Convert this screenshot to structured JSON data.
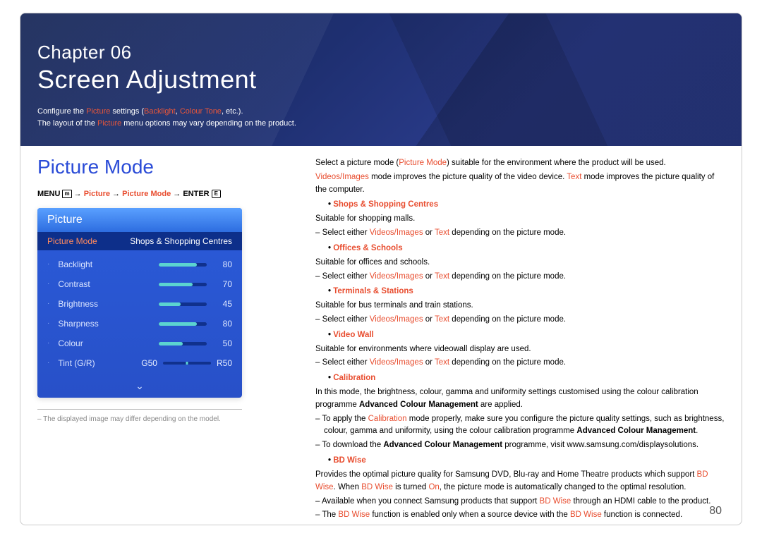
{
  "header": {
    "chapter": "Chapter  06",
    "title": "Screen Adjustment",
    "desc_pre": "Configure the ",
    "desc_picture": "Picture",
    "desc_mid": " settings (",
    "desc_opt1": "Backlight",
    "desc_sep": ", ",
    "desc_opt2": "Colour Tone",
    "desc_post": ", etc.).",
    "desc2_pre": "The layout of the ",
    "desc2_picture": "Picture",
    "desc2_post": " menu options may vary depending on the product."
  },
  "left": {
    "heading": "Picture Mode",
    "nav": {
      "menu": "MENU",
      "arrow": " → ",
      "picture": "Picture",
      "picmode": "Picture Mode",
      "enter": "ENTER"
    },
    "osd": {
      "title": "Picture",
      "modeLabel": "Picture Mode",
      "modeValue": "Shops & Shopping Centres",
      "rows": [
        {
          "label": "Backlight",
          "value": "80",
          "fill": "80%"
        },
        {
          "label": "Contrast",
          "value": "70",
          "fill": "70%"
        },
        {
          "label": "Brightness",
          "value": "45",
          "fill": "45%"
        },
        {
          "label": "Sharpness",
          "value": "80",
          "fill": "80%"
        },
        {
          "label": "Colour",
          "value": "50",
          "fill": "50%"
        }
      ],
      "tint": {
        "label": "Tint (G/R)",
        "g": "G50",
        "r": "R50"
      }
    },
    "footnote": "The displayed image may differ depending on the model."
  },
  "right": {
    "intro1a": "Select a picture mode (",
    "intro1b": "Picture Mode",
    "intro1c": ") suitable for the environment where the product will be used.",
    "intro2a": "Videos/Images",
    "intro2b": " mode improves the picture quality of the video device. ",
    "intro2c": "Text",
    "intro2d": " mode improves the picture quality of the computer.",
    "modes": [
      {
        "title": "Shops & Shopping Centres",
        "desc": "Suitable for shopping malls.",
        "dash_pre": "Select either ",
        "dash_a": "Videos/Images",
        "dash_mid": " or ",
        "dash_b": "Text",
        "dash_post": " depending on the picture mode."
      },
      {
        "title": "Offices & Schools",
        "desc": "Suitable for offices and schools.",
        "dash_pre": "Select either ",
        "dash_a": "Videos/Images",
        "dash_mid": " or ",
        "dash_b": "Text",
        "dash_post": " depending on the picture mode."
      },
      {
        "title": "Terminals & Stations",
        "desc": "Suitable for bus terminals and train stations.",
        "dash_pre": "Select either ",
        "dash_a": "Videos/Images",
        "dash_mid": " or ",
        "dash_b": "Text",
        "dash_post": " depending on the picture mode."
      },
      {
        "title": "Video Wall",
        "desc": "Suitable for environments where videowall display are used.",
        "dash_pre": "Select either ",
        "dash_a": "Videos/Images",
        "dash_mid": " or ",
        "dash_b": "Text",
        "dash_post": " depending on the picture mode."
      }
    ],
    "calibration": {
      "title": "Calibration",
      "desc1_pre": "In this mode, the brightness, colour, gamma and uniformity settings customised using the colour calibration programme ",
      "desc1_b": "Advanced Colour Management",
      "desc1_post": " are applied.",
      "d1_pre": "To apply the ",
      "d1_cal": "Calibration",
      "d1_mid": " mode properly, make sure you configure the picture quality settings, such as brightness, colour, gamma and uniformity, using the colour calibration programme ",
      "d1_b": "Advanced Colour Management",
      "d1_post": ".",
      "d2_pre": "To download the ",
      "d2_b": "Advanced Colour Management",
      "d2_post": " programme, visit www.samsung.com/displaysolutions."
    },
    "bdwise": {
      "title": "BD Wise",
      "p1_pre": "Provides the optimal picture quality for Samsung DVD, Blu-ray and Home Theatre products which support ",
      "p1_bd": "BD Wise",
      "p1_mid1": ". When ",
      "p1_bd2": "BD Wise",
      "p1_mid2": " is turned ",
      "p1_on": "On",
      "p1_post": ", the picture mode is automatically changed to the optimal resolution.",
      "d1_pre": "Available when you connect Samsung products that support ",
      "d1_bd": "BD Wise",
      "d1_post": " through an HDMI cable to the product.",
      "d2_pre": "The ",
      "d2_bd": "BD Wise",
      "d2_mid": " function is enabled only when a source device with the ",
      "d2_bd2": "BD Wise",
      "d2_post": " function is connected."
    }
  },
  "pageNumber": "80"
}
